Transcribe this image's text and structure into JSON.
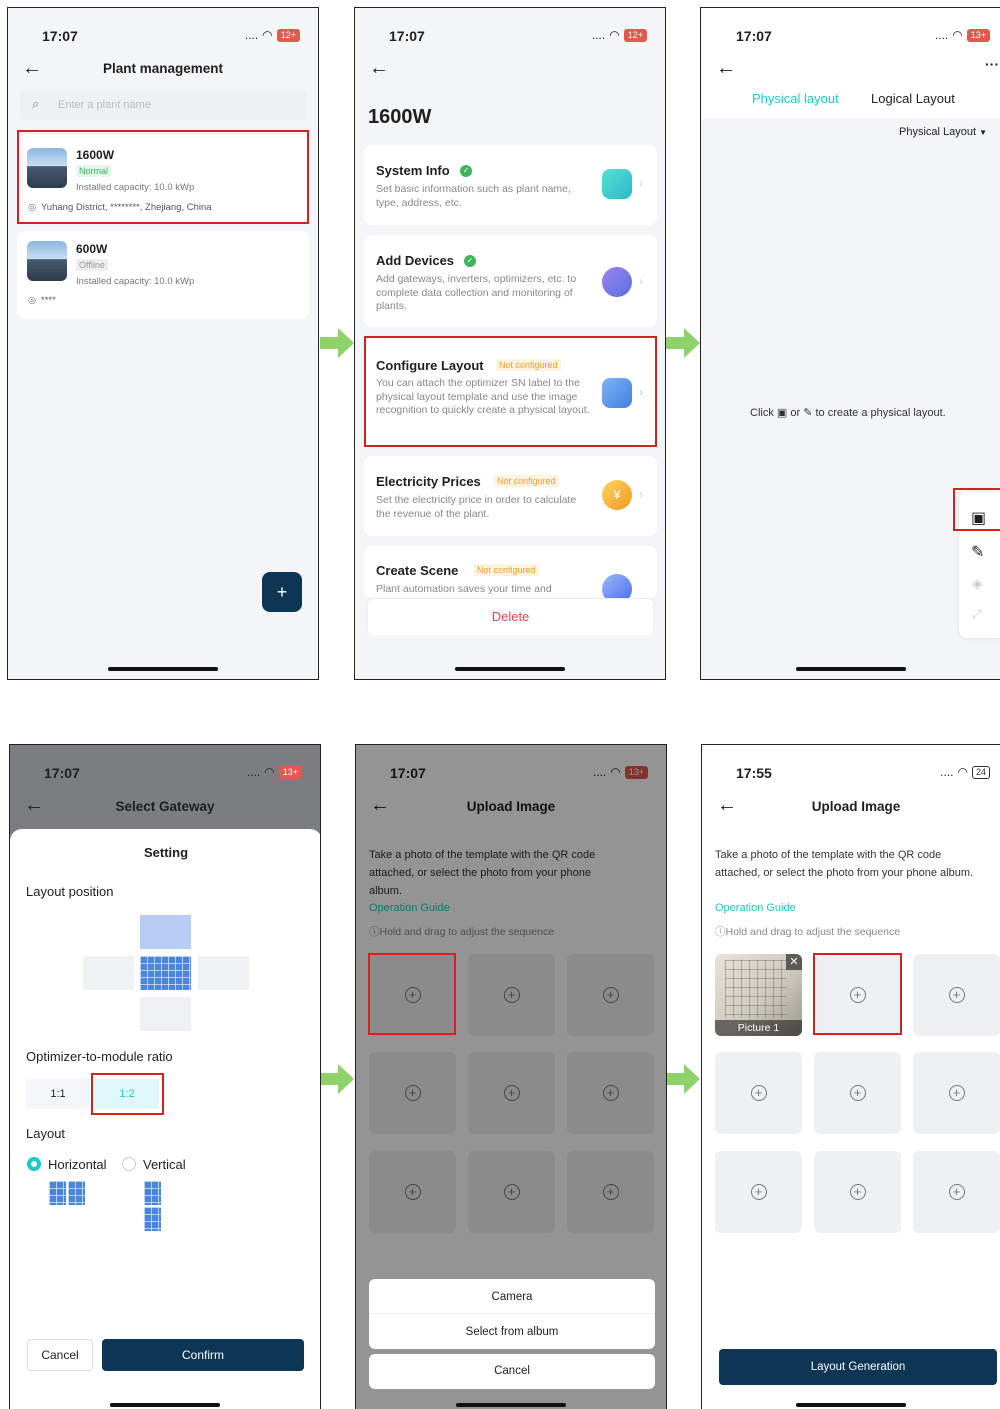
{
  "status": {
    "time_a": "17:07",
    "time_b": "17:55",
    "battery_top": "12+",
    "battery_bottom": "13+",
    "battery_b3": "13+",
    "battery_last": "24",
    "dots": "....",
    "wifi": "wifi-icon"
  },
  "screen1": {
    "title": "Plant management",
    "search_placeholder": "Enter a plant name",
    "plants": [
      {
        "name": "1600W",
        "status": "Normal",
        "capacity": "Installed capacity: 10.0 kWp",
        "address": "Yuhang District, ********, Zhejiang, China"
      },
      {
        "name": "600W",
        "status": "Offline",
        "capacity": "Installed capacity: 10.0 kWp",
        "address": "****"
      }
    ],
    "fab": "+"
  },
  "screen2": {
    "title": "1600W",
    "steps": [
      {
        "title": "System Info",
        "desc": "Set basic information such as plant name, type, address, etc."
      },
      {
        "title": "Add Devices",
        "desc": "Add gateways, inverters, optimizers, etc. to complete data collection and monitoring of plants."
      },
      {
        "title": "Configure Layout",
        "tag": "Not configured",
        "desc": "You can attach the optimizer SN label to the physical layout template and use the image recognition to quickly create a physical layout."
      },
      {
        "title": "Electricity Prices",
        "tag": "Not configured",
        "desc": "Set the electricity price in order to calculate the revenue of the plant."
      },
      {
        "title": "Create Scene",
        "tag": "Not configured",
        "desc": "Plant automation saves your time and"
      }
    ],
    "delete": "Delete"
  },
  "screen3": {
    "tab_physical": "Physical layout",
    "tab_logical": "Logical Layout",
    "dropdown": "Physical Layout",
    "hint_before": "Click",
    "hint_or": "or",
    "hint_after": "to create a physical layout.",
    "more": "···"
  },
  "screen4": {
    "title": "Select Gateway",
    "sheet_title": "Setting",
    "layout_position": "Layout position",
    "ratio_label": "Optimizer-to-module ratio",
    "ratio_options": [
      "1:1",
      "1:2"
    ],
    "layout_label": "Layout",
    "horizontal": "Horizontal",
    "vertical": "Vertical",
    "cancel": "Cancel",
    "confirm": "Confirm"
  },
  "upload": {
    "title": "Upload Image",
    "instruction": "Take a photo of the template with the QR code attached, or select the photo from your phone album.",
    "guide": "Operation Guide",
    "tip": "ⓘHold and drag to adjust the sequence",
    "camera": "Camera",
    "album": "Select from album",
    "cancel": "Cancel",
    "picture_label": "Picture 1",
    "generate": "Layout Generation"
  },
  "colors": {
    "accent": "#1ec8c8",
    "dark_button": "#0d3554",
    "highlight": "#d42121",
    "flow_arrow": "#8fd16a"
  }
}
